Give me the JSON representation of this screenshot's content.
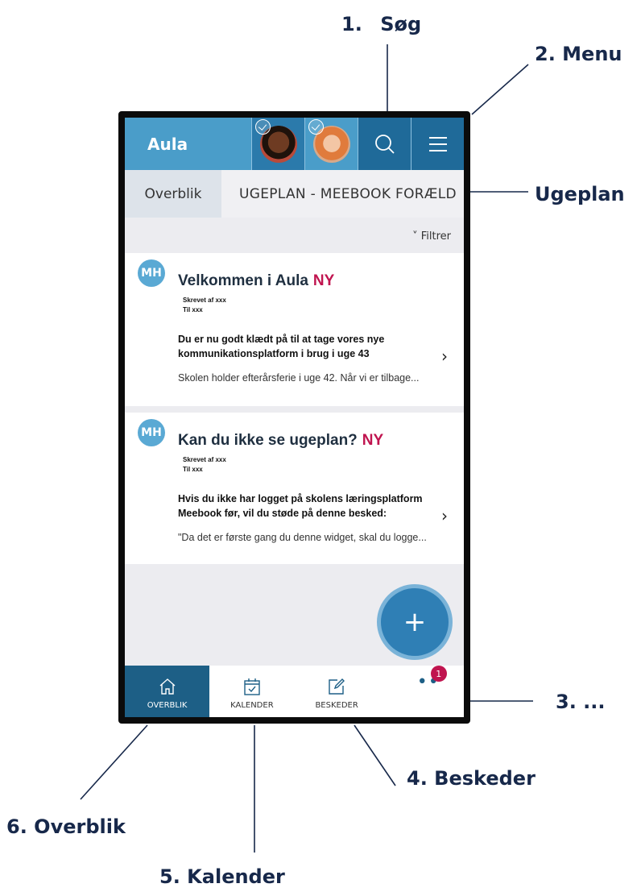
{
  "callouts": {
    "search_num": "1.",
    "search": "Søg",
    "menu": "2. Menu",
    "ugeplan": "Ugeplan",
    "more": "3. ...",
    "beskeder": "4. Beskeder",
    "kalender": "5. Kalender",
    "overblik": "6. Overblik"
  },
  "header": {
    "brand": "Aula"
  },
  "tabs": [
    {
      "label": "Overblik",
      "active": true
    },
    {
      "label": "UGEPLAN - MEEBOOK FORÆLD"
    }
  ],
  "filter_label": "˅ Filtrer",
  "posts": [
    {
      "avatar": "MH",
      "title": "Velkommen i Aula",
      "badge": "NY",
      "author": "Skrevet af xxx",
      "to": "Til xxx",
      "line1": "Du er nu godt klædt på til at tage vores nye",
      "line2": "kommunikationsplatform i brug i uge 43",
      "preview": "Skolen holder efterårsferie i uge 42. Når vi er tilbage..."
    },
    {
      "avatar": "MH",
      "title": "Kan du ikke se ugeplan?",
      "badge": "NY",
      "author": "Skrevet af xxx",
      "to": "Til xxx",
      "line1": "Hvis du ikke har logget på skolens læringsplatform",
      "line2": "Meebook før, vil du støde på denne besked:",
      "preview": "\"Da det er første gang du denne widget, skal du logge..."
    }
  ],
  "fab": "+",
  "bottom_nav": [
    {
      "label": "OVERBLIK",
      "icon": "home-icon",
      "active": true
    },
    {
      "label": "KALENDER",
      "icon": "calendar-icon"
    },
    {
      "label": "BESKEDER",
      "icon": "compose-icon"
    }
  ],
  "more_badge": "1",
  "colors": {
    "header": "#4a9dc9",
    "nav_active": "#1d5f86",
    "badge": "#c0144f",
    "fab": "#2f7fb5"
  }
}
